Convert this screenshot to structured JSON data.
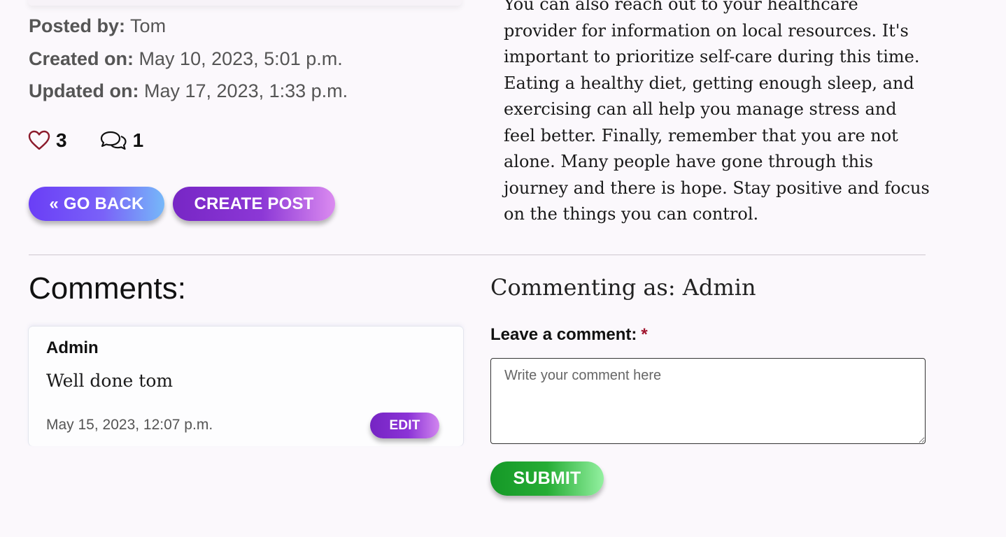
{
  "post_meta": {
    "posted_by_label": "Posted by:",
    "posted_by": "Tom",
    "created_label": "Created on:",
    "created": "May 10, 2023, 5:01 p.m.",
    "updated_label": "Updated on:",
    "updated": "May 17, 2023, 1:33 p.m."
  },
  "stats": {
    "likes_icon": "heart-outline-icon",
    "likes": "3",
    "comments_icon": "chat-bubbles-icon",
    "comments": "1"
  },
  "buttons": {
    "go_back": "« GO BACK",
    "create_post": "CREATE POST"
  },
  "article": {
    "text": "You can also reach out to your healthcare provider for information on local resources. It's important to prioritize self-care during this time. Eating a healthy diet, getting enough sleep, and exercising can all help you manage stress and feel better. Finally, remember that you are not alone. Many people have gone through this journey and there is hope. Stay positive and focus on the things you can control."
  },
  "comments": {
    "title": "Comments:",
    "items": [
      {
        "author": "Admin",
        "body": "Well done tom",
        "date": "May 15, 2023, 12:07 p.m.",
        "edit_label": "EDIT"
      }
    ]
  },
  "comment_form": {
    "commenting_as": "Commenting as: Admin",
    "label": "Leave a comment:",
    "required_marker": "*",
    "placeholder": "Write your comment here",
    "value": "",
    "submit_label": "SUBMIT"
  },
  "colors": {
    "heart": "#8b1a2b",
    "required": "#a0142e",
    "go_back_gradient": [
      "#6a3ef6",
      "#76b8f9"
    ],
    "create_post_gradient": [
      "#7726c5",
      "#db8bf0"
    ],
    "submit_gradient": [
      "#159827",
      "#93f0a0"
    ]
  }
}
